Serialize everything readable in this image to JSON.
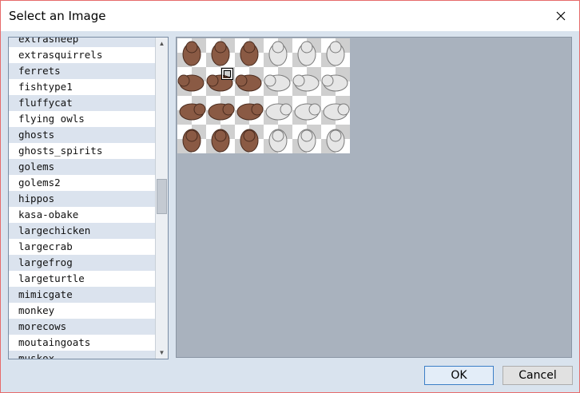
{
  "window": {
    "title": "Select an Image"
  },
  "titlebar": {
    "close_icon": "close-icon"
  },
  "file_list": {
    "items": [
      "extrasheep",
      "extrasquirrels",
      "ferrets",
      "fishtype1",
      "fluffycat",
      "flying owls",
      "ghosts",
      "ghosts_spirits",
      "golems",
      "golems2",
      "hippos",
      "kasa-obake",
      "largechicken",
      "largecrab",
      "largefrog",
      "largeturtle",
      "mimicgate",
      "monkey",
      "morecows",
      "moutaingoats",
      "muskox"
    ]
  },
  "preview": {
    "description_icon": "sprite-sheet",
    "colors": {
      "brown_bear": "#8a5a44",
      "white_bear": "#e6e6e6",
      "checker_light": "#ffffff",
      "checker_dark": "#cfcfcf",
      "background": "#a9b2be"
    }
  },
  "buttons": {
    "ok_label": "OK",
    "cancel_label": "Cancel"
  }
}
